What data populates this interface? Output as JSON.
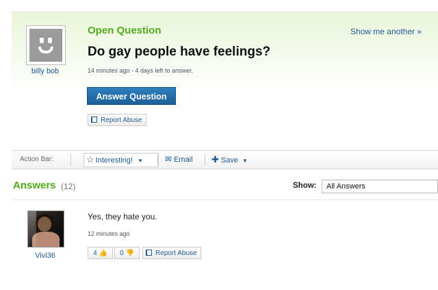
{
  "question": {
    "status": "Open Question",
    "title": "Do gay people have feelings?",
    "meta": "14 minutes ago - 4 days left to answer.",
    "asker": "billy bob",
    "show_another": "Show me another »",
    "answer_button": "Answer Question",
    "report_abuse": "Report Abuse"
  },
  "action_bar": {
    "label": "Action Bar:",
    "interesting": "Interesting!",
    "email": "Email",
    "save": "Save"
  },
  "answers": {
    "title": "Answers",
    "count": "(12)",
    "show_label": "Show:",
    "show_value": "All Answers",
    "items": [
      {
        "text": "Yes, they hate you.",
        "meta": "12 minutes ago",
        "author": "Vivi36",
        "thumbs_up": "4",
        "thumbs_down": "0",
        "report_abuse": "Report Abuse"
      }
    ]
  },
  "colors": {
    "accent_green": "#4faa1a",
    "link_blue": "#1b5a95",
    "button_blue": "#1d5f98"
  }
}
